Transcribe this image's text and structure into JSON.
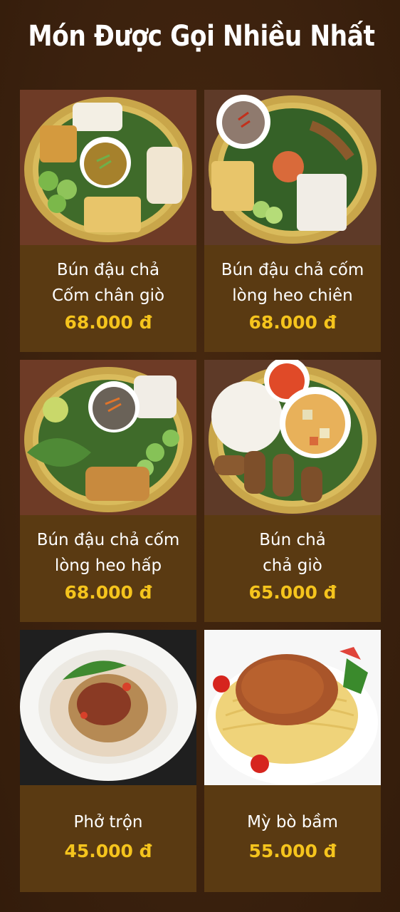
{
  "title": "Món Được Gọi Nhiều Nhất",
  "colors": {
    "background": "#3b210e",
    "card": "#5a3a12",
    "price": "#f5c41d",
    "text": "#ffffff"
  },
  "items": [
    {
      "name_line1": "Bún đậu chả",
      "name_line2": "Cốm chân giò",
      "price": "68.000 đ"
    },
    {
      "name_line1": "Bún đậu chả cốm",
      "name_line2": "lòng heo chiên",
      "price": "68.000 đ"
    },
    {
      "name_line1": "Bún đậu chả cốm",
      "name_line2": "lòng heo hấp",
      "price": "68.000 đ"
    },
    {
      "name_line1": "Bún chả",
      "name_line2": "chả giò",
      "price": "65.000 đ"
    },
    {
      "name_line1": "Phở trộn",
      "name_line2": "",
      "price": "45.000 đ"
    },
    {
      "name_line1": "Mỳ bò bầm",
      "name_line2": "",
      "price": "55.000 đ"
    }
  ]
}
